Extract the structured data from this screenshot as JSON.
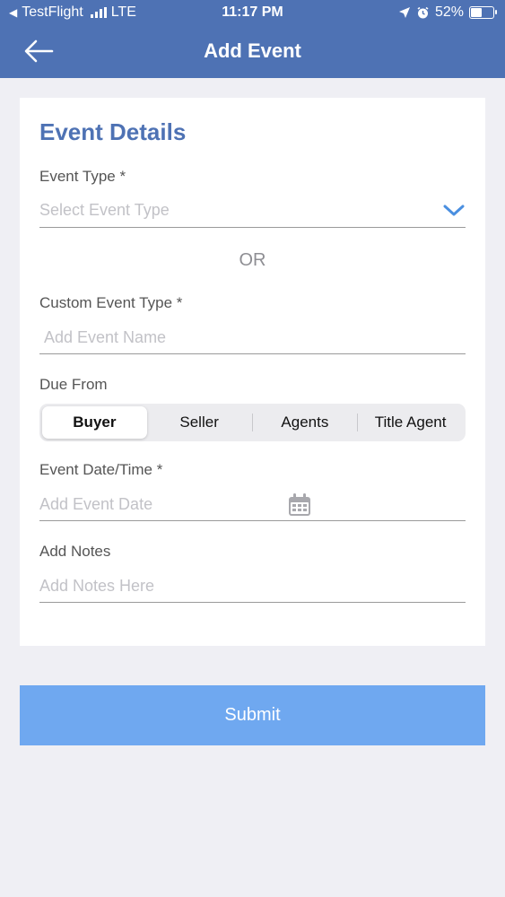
{
  "status_bar": {
    "carrier_back": "◀",
    "app": "TestFlight",
    "network": "LTE",
    "time": "11:17 PM",
    "battery": "52%",
    "battery_level": 0.52
  },
  "header": {
    "title": "Add Event",
    "back_icon": "arrow-left-icon",
    "background": "#4e72b4"
  },
  "form": {
    "section_title": "Event Details",
    "event_type": {
      "label": "Event Type *",
      "placeholder": "Select Event Type"
    },
    "or_text": "OR",
    "custom_event_type": {
      "label": "Custom Event Type *",
      "placeholder": "Add Event Name"
    },
    "due_from": {
      "label": "Due From",
      "options": [
        "Buyer",
        "Seller",
        "Agents",
        "Title Agent"
      ],
      "selected": "Buyer"
    },
    "event_date": {
      "label": "Event Date/Time *",
      "placeholder": "Add Event Date"
    },
    "notes": {
      "label": "Add Notes",
      "placeholder": "Add Notes Here"
    }
  },
  "submit": {
    "label": "Submit",
    "background": "#6fa8f0"
  },
  "colors": {
    "accent": "#4e72b4",
    "chevron": "#4a8fe0",
    "page_background": "#efeff4"
  }
}
